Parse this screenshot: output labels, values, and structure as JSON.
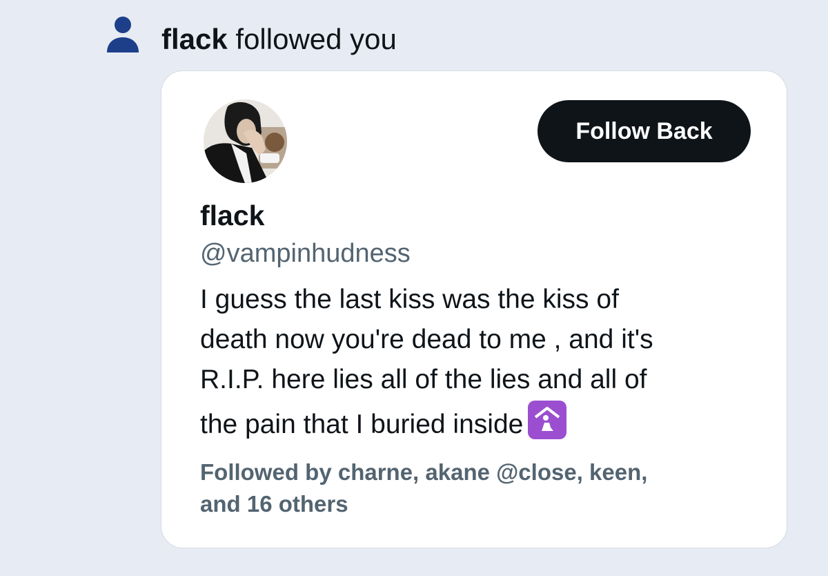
{
  "notification": {
    "icon": "person-icon",
    "actor": "flack",
    "action_text": "followed you"
  },
  "profile_card": {
    "avatar": "avatar",
    "follow_button_label": "Follow Back",
    "display_name": "flack",
    "handle": "@vampinhudness",
    "bio_lines": [
      "I guess the last kiss was the kiss of",
      "death now you're dead to me , and it's",
      "R.I.P. here lies all of the lies and all of",
      "the pain that I buried inside"
    ],
    "bio_emoji": "place-of-worship-emoji-icon",
    "followed_by_lines": [
      "Followed by charne, akane @close, keen,",
      "and 16 others"
    ]
  },
  "colors": {
    "background": "#e7ebf3",
    "card": "#ffffff",
    "accent_icon": "#1d3f8a",
    "button": "#0f1419",
    "secondary_text": "#536471",
    "emoji_purple": "#9b4fd0"
  }
}
